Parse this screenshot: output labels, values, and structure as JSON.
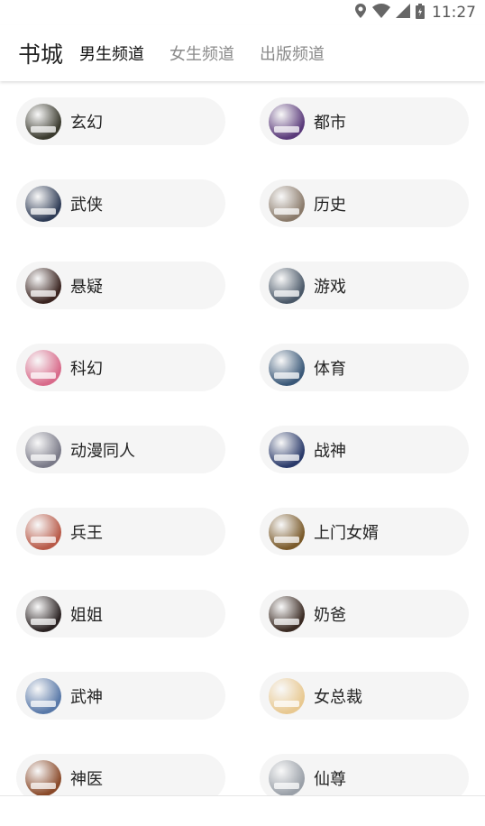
{
  "status_bar": {
    "time": "11:27"
  },
  "header": {
    "brand": "书城",
    "tabs": [
      {
        "label": "男生频道",
        "active": true
      },
      {
        "label": "女生频道",
        "active": false
      },
      {
        "label": "出版频道",
        "active": false
      }
    ]
  },
  "categories": [
    {
      "label": "玄幻",
      "cover": "#3a3a2e"
    },
    {
      "label": "都市",
      "cover": "#5a3a7a"
    },
    {
      "label": "武侠",
      "cover": "#2e3b55"
    },
    {
      "label": "历史",
      "cover": "#8a7a6a"
    },
    {
      "label": "悬疑",
      "cover": "#3a2420"
    },
    {
      "label": "游戏",
      "cover": "#4a5868"
    },
    {
      "label": "科幻",
      "cover": "#d86a8a"
    },
    {
      "label": "体育",
      "cover": "#3a5878"
    },
    {
      "label": "动漫同人",
      "cover": "#7a7a88"
    },
    {
      "label": "战神",
      "cover": "#2a3a6a"
    },
    {
      "label": "兵王",
      "cover": "#b85a48"
    },
    {
      "label": "上门女婿",
      "cover": "#7a5a2a"
    },
    {
      "label": "姐姐",
      "cover": "#2a2222"
    },
    {
      "label": "奶爸",
      "cover": "#3a2a22"
    },
    {
      "label": "武神",
      "cover": "#5878a8"
    },
    {
      "label": "女总裁",
      "cover": "#e8c890"
    },
    {
      "label": "神医",
      "cover": "#8a4a2a"
    },
    {
      "label": "仙尊",
      "cover": "#9aa0a8"
    }
  ]
}
